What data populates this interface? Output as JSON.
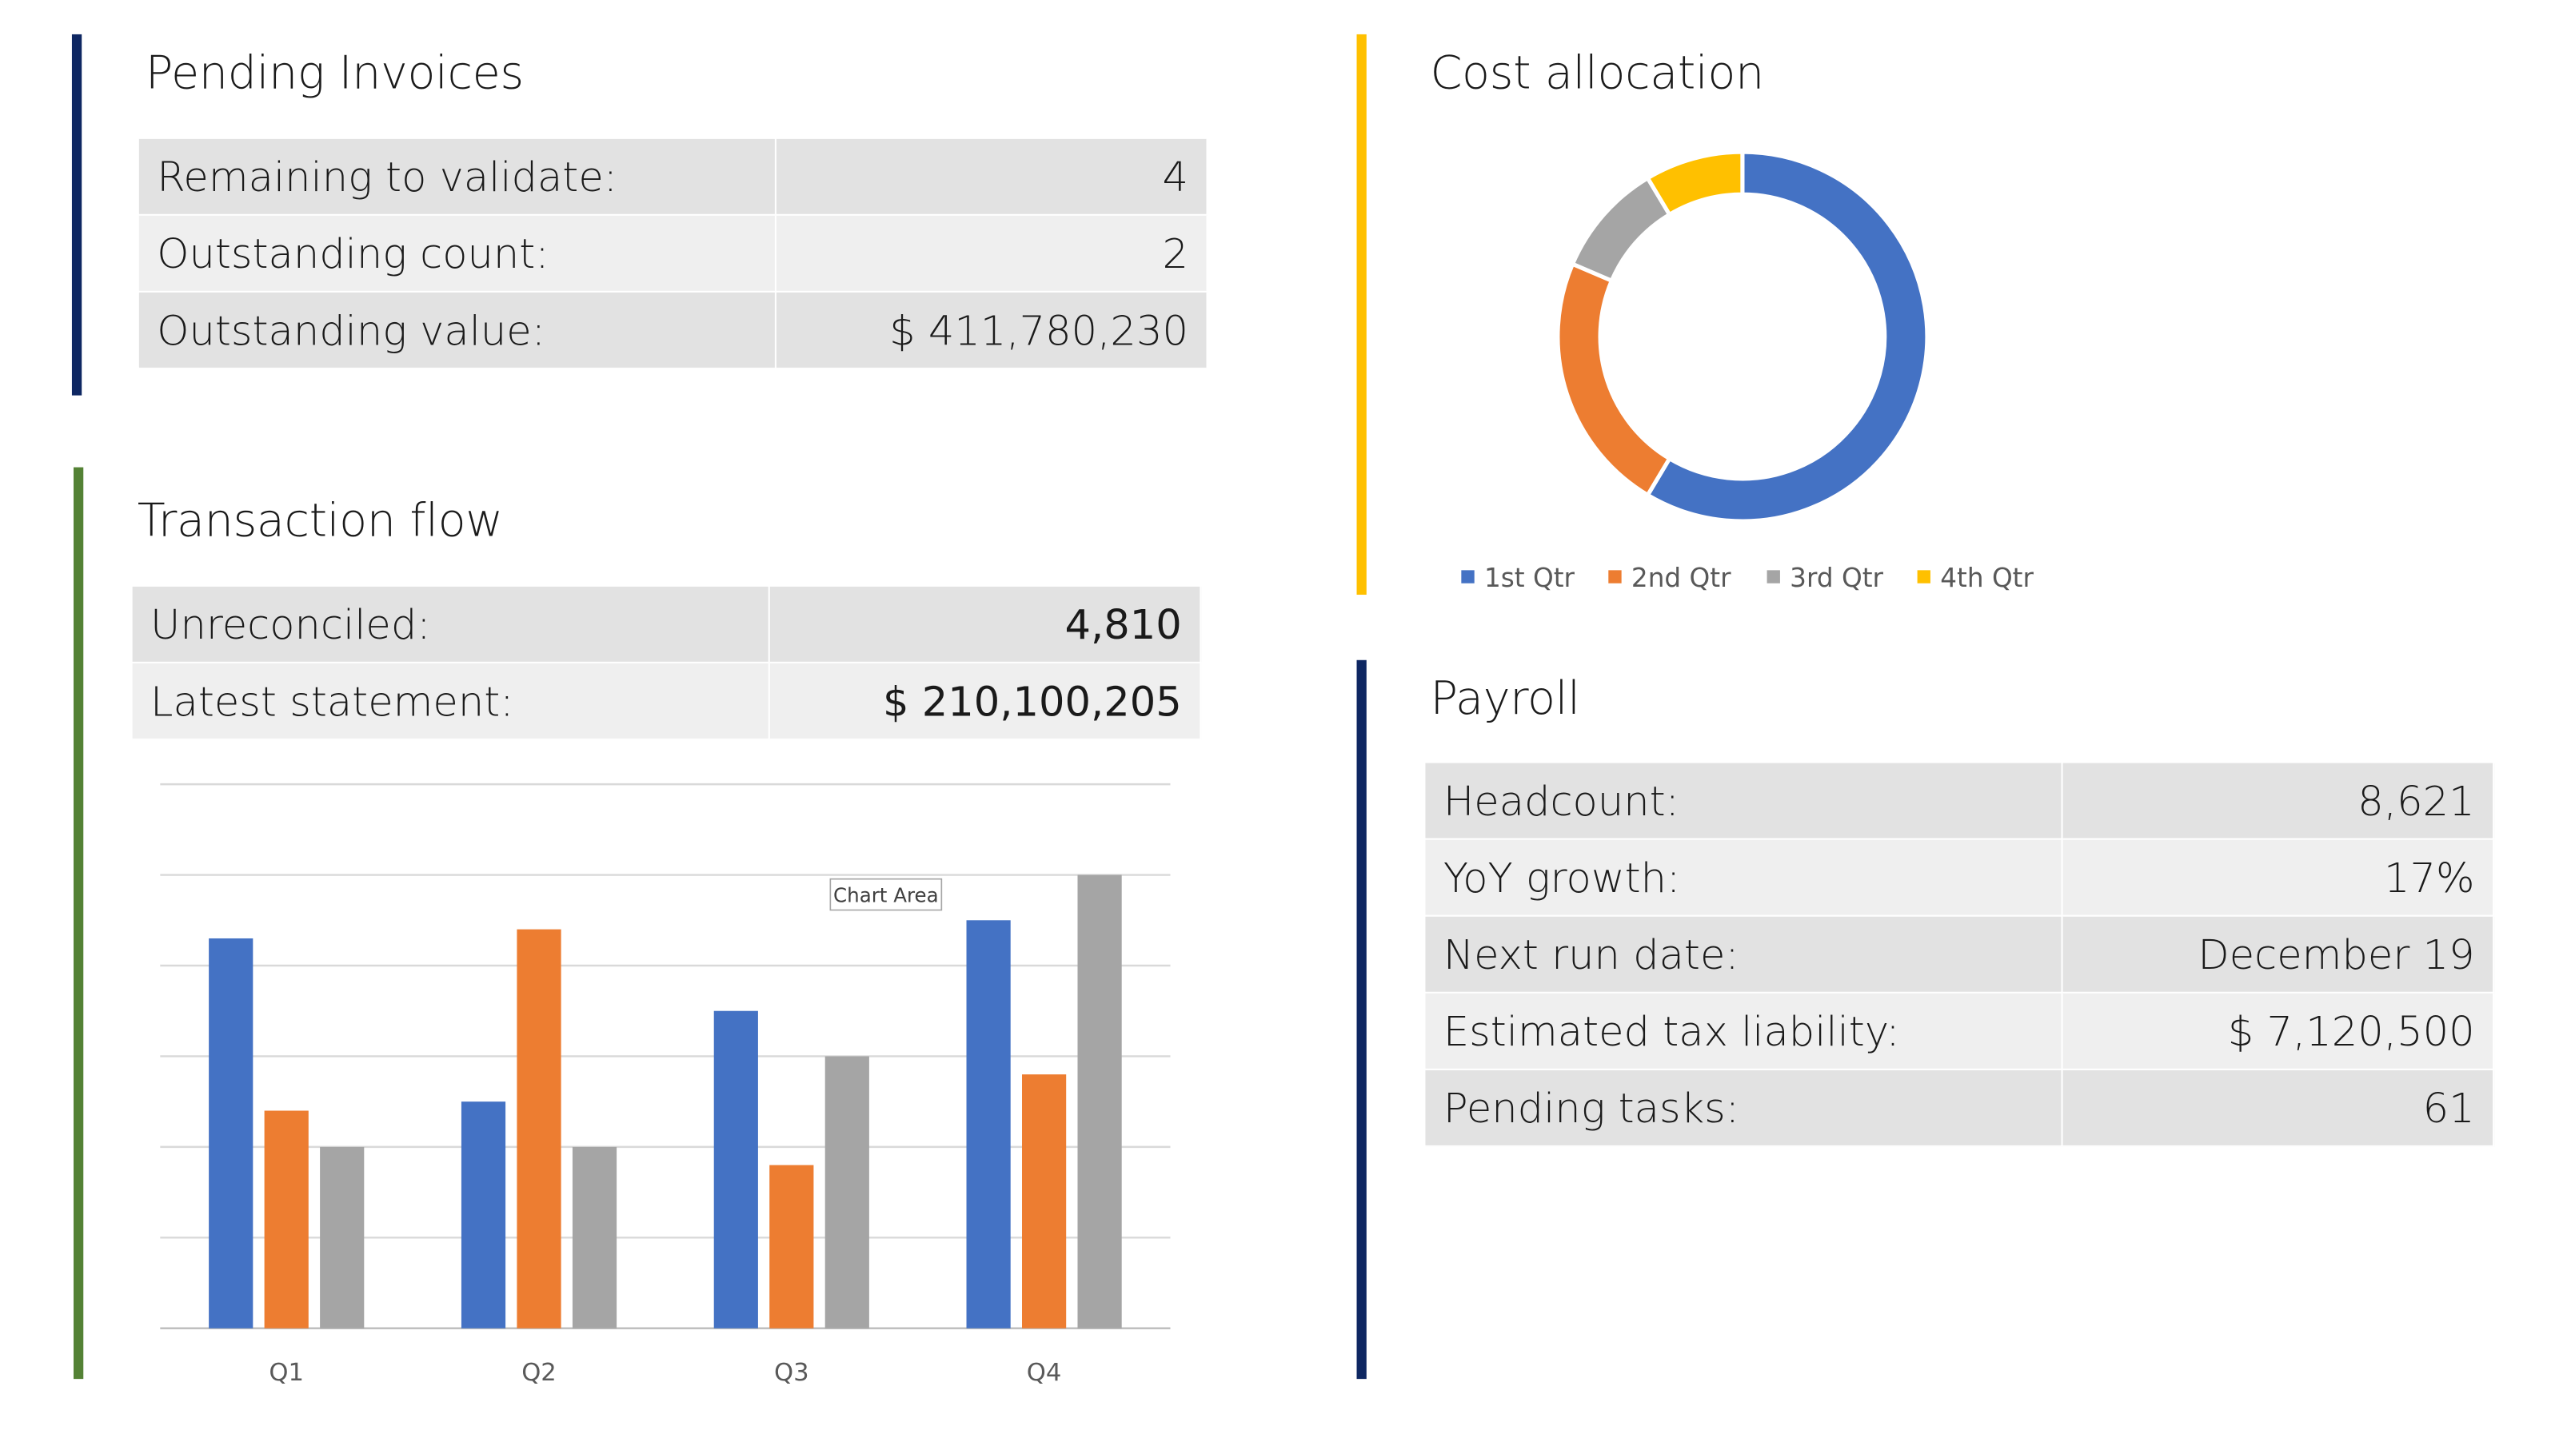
{
  "colors": {
    "blue": "#4472c4",
    "orange": "#ed7d31",
    "gray": "#a5a5a5",
    "yellow": "#ffc000",
    "navy": "#0e2762",
    "green": "#548235",
    "gold": "#ffc000"
  },
  "pending_invoices": {
    "title": "Pending Invoices",
    "rows": [
      {
        "label": "Remaining to validate:",
        "value": "4"
      },
      {
        "label": "Outstanding count:",
        "value": "2"
      },
      {
        "label": "Outstanding value:",
        "value": "$ 411,780,230"
      }
    ]
  },
  "transaction_flow": {
    "title": "Transaction flow",
    "rows": [
      {
        "label": "Unreconciled:",
        "value": "4,810"
      },
      {
        "label": "Latest statement:",
        "value": "$ 210,100,205"
      }
    ],
    "tooltip": "Chart Area"
  },
  "cost_allocation": {
    "title": "Cost allocation"
  },
  "payroll": {
    "title": "Payroll",
    "rows": [
      {
        "label": "Headcount:",
        "value": "8,621"
      },
      {
        "label": "YoY growth:",
        "value": "17%"
      },
      {
        "label": "Next run date:",
        "value": "December 19"
      },
      {
        "label": "Estimated tax liability:",
        "value": "$ 7,120,500"
      },
      {
        "label": "Pending tasks:",
        "value": "61"
      }
    ]
  },
  "chart_data": [
    {
      "type": "bar",
      "categories": [
        "Q1",
        "Q2",
        "Q3",
        "Q4"
      ],
      "series": [
        {
          "values": [
            4.3,
            2.5,
            3.5,
            4.5
          ]
        },
        {
          "values": [
            2.4,
            4.4,
            1.8,
            2.8
          ]
        },
        {
          "values": [
            2.0,
            2.0,
            3.0,
            5.0
          ]
        }
      ],
      "ylim": [
        0,
        6
      ],
      "grid": true,
      "legend": "none"
    },
    {
      "type": "pie",
      "style": "donut",
      "labels": [
        "1st Qtr",
        "2nd Qtr",
        "3rd Qtr",
        "4th Qtr"
      ],
      "values": [
        8.2,
        3.2,
        1.4,
        1.2
      ],
      "legend": "bottom"
    }
  ]
}
